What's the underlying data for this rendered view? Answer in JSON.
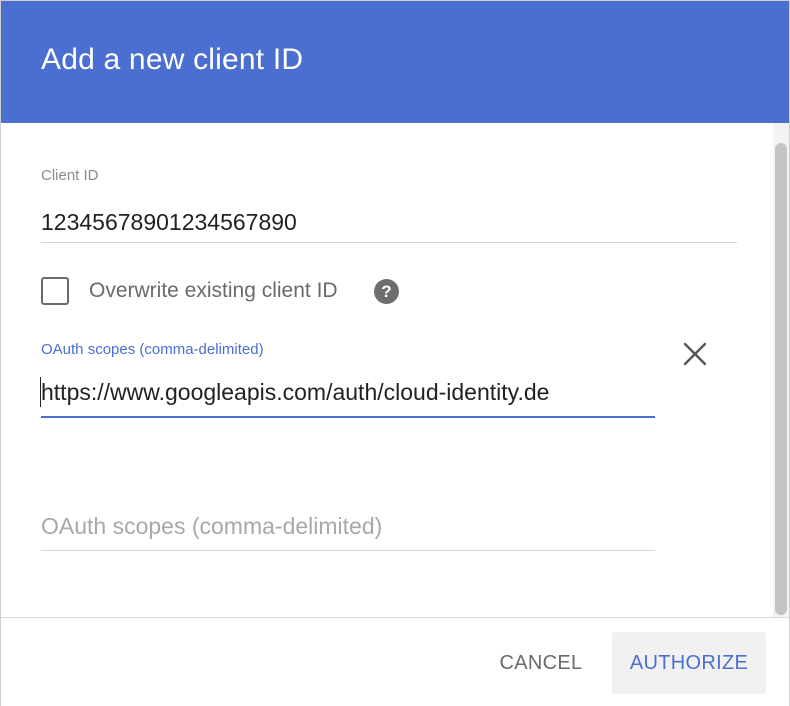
{
  "dialog": {
    "title": "Add a new client ID"
  },
  "client_id": {
    "label": "Client ID",
    "value": "12345678901234567890"
  },
  "overwrite": {
    "label": "Overwrite existing client ID",
    "checked": false,
    "help_icon": "help-icon",
    "help_glyph": "?"
  },
  "scopes": [
    {
      "label": "OAuth scopes (comma-delimited)",
      "value": "https://www.googleapis.com/auth/cloud-identity.de",
      "focused": true
    },
    {
      "placeholder": "OAuth scopes (comma-delimited)",
      "value": ""
    }
  ],
  "footer": {
    "cancel_label": "CANCEL",
    "authorize_label": "AUTHORIZE"
  },
  "colors": {
    "header": "#4a6fd0",
    "accent": "#4a6fd0"
  }
}
